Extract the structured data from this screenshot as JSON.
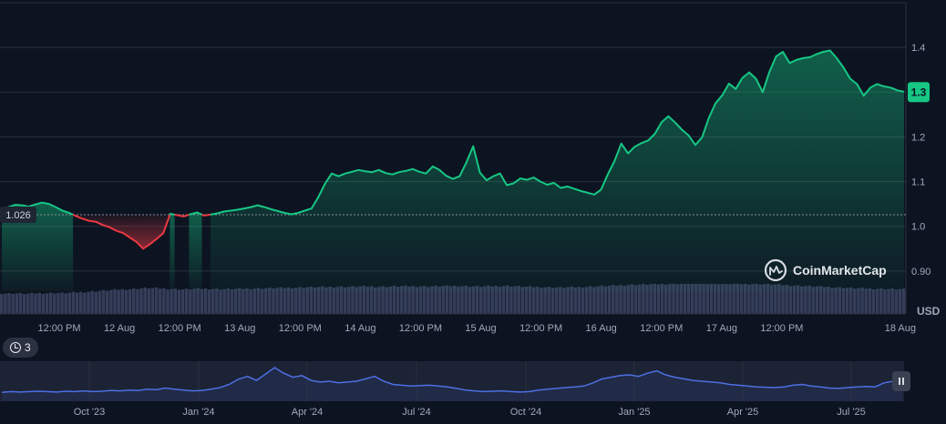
{
  "brand": {
    "name": "CoinMarketCap"
  },
  "currency_label": "USD",
  "history_badge": {
    "count": "3"
  },
  "last_price_label": "1.3",
  "start_price_label": "1.026",
  "colors": {
    "up": "#16c784",
    "down": "#ea3943",
    "volume": "#353e59",
    "navigator": "#4d6fe3",
    "background": "#0d1421",
    "grid": "#2a2f3d"
  },
  "chart_data": {
    "type": "area",
    "start_value": 1.026,
    "last_value": 1.3,
    "ylim": [
      0.855,
      1.506
    ],
    "y_ticks": [
      0.9,
      1.0,
      1.1,
      1.2,
      1.3,
      1.4
    ],
    "y_tick_labels": [
      "0.90",
      "1.0",
      "1.1",
      "1.2",
      "1.3",
      "1.4"
    ],
    "x_tick_labels": [
      "12:00 PM",
      "12 Aug",
      "12:00 PM",
      "13 Aug",
      "12:00 PM",
      "14 Aug",
      "12:00 PM",
      "15 Aug",
      "12:00 PM",
      "16 Aug",
      "12:00 PM",
      "17 Aug",
      "12:00 PM",
      "18 Aug"
    ],
    "price_series": [
      1.04,
      1.043,
      1.048,
      1.047,
      1.044,
      1.049,
      1.053,
      1.05,
      1.043,
      1.035,
      1.03,
      1.023,
      1.017,
      1.012,
      1.01,
      1.003,
      0.998,
      0.99,
      0.985,
      0.975,
      0.965,
      0.95,
      0.96,
      0.972,
      0.985,
      1.028,
      1.025,
      1.022,
      1.027,
      1.031,
      1.024,
      1.026,
      1.029,
      1.033,
      1.035,
      1.037,
      1.04,
      1.043,
      1.047,
      1.043,
      1.038,
      1.034,
      1.03,
      1.027,
      1.03,
      1.035,
      1.04,
      1.065,
      1.095,
      1.118,
      1.112,
      1.118,
      1.122,
      1.126,
      1.123,
      1.121,
      1.126,
      1.119,
      1.116,
      1.121,
      1.124,
      1.128,
      1.122,
      1.118,
      1.134,
      1.126,
      1.113,
      1.106,
      1.112,
      1.143,
      1.179,
      1.12,
      1.103,
      1.112,
      1.118,
      1.092,
      1.096,
      1.107,
      1.104,
      1.109,
      1.1,
      1.093,
      1.097,
      1.086,
      1.089,
      1.084,
      1.079,
      1.075,
      1.071,
      1.082,
      1.116,
      1.146,
      1.185,
      1.163,
      1.178,
      1.186,
      1.192,
      1.207,
      1.233,
      1.246,
      1.232,
      1.216,
      1.203,
      1.182,
      1.199,
      1.242,
      1.275,
      1.293,
      1.319,
      1.307,
      1.332,
      1.344,
      1.33,
      1.3,
      1.345,
      1.38,
      1.39,
      1.365,
      1.372,
      1.376,
      1.378,
      1.385,
      1.39,
      1.393,
      1.376,
      1.355,
      1.33,
      1.318,
      1.292,
      1.31,
      1.318,
      1.313,
      1.31,
      1.304,
      1.301
    ],
    "volume_series": [
      0.32,
      0.3,
      0.33,
      0.31,
      0.3,
      0.32,
      0.34,
      0.33,
      0.35,
      0.34,
      0.36,
      0.38,
      0.4,
      0.43,
      0.46,
      0.5,
      0.53,
      0.56,
      0.58,
      0.6,
      0.63,
      0.66,
      0.68,
      0.66,
      0.64,
      0.62,
      0.6,
      0.59,
      0.6,
      0.62,
      0.63,
      0.62,
      0.61,
      0.6,
      0.61,
      0.62,
      0.63,
      0.64,
      0.65,
      0.66,
      0.67,
      0.68,
      0.69,
      0.7,
      0.71,
      0.72,
      0.73,
      0.74,
      0.74,
      0.75,
      0.76,
      0.76,
      0.77,
      0.77,
      0.78,
      0.77,
      0.76,
      0.77,
      0.78,
      0.79,
      0.8,
      0.8,
      0.79,
      0.78,
      0.79,
      0.8,
      0.81,
      0.82,
      0.81,
      0.8,
      0.79,
      0.78,
      0.79,
      0.8,
      0.81,
      0.82,
      0.8,
      0.78,
      0.76,
      0.75,
      0.74,
      0.73,
      0.72,
      0.71,
      0.72,
      0.73,
      0.74,
      0.76,
      0.78,
      0.8,
      0.82,
      0.84,
      0.86,
      0.88,
      0.9,
      0.91,
      0.92,
      0.93,
      0.94,
      0.95,
      0.96,
      0.97,
      0.98,
      0.99,
      1.0,
      0.99,
      0.98,
      0.97,
      0.96,
      0.95,
      0.94,
      0.95,
      0.96,
      0.94,
      0.92,
      0.9,
      0.88,
      0.86,
      0.84,
      0.82,
      0.8,
      0.78,
      0.76,
      0.74,
      0.72,
      0.7,
      0.68,
      0.66,
      0.65,
      0.64,
      0.63,
      0.62,
      0.61,
      0.6,
      0.59
    ],
    "navigator": {
      "x_tick_labels": [
        "Oct '23",
        "Jan '24",
        "Apr '24",
        "Jul '24",
        "Oct '24",
        "Jan '25",
        "Apr '25",
        "Jul '25"
      ],
      "series": [
        0.22,
        0.24,
        0.23,
        0.24,
        0.25,
        0.24,
        0.23,
        0.25,
        0.24,
        0.26,
        0.24,
        0.25,
        0.27,
        0.26,
        0.28,
        0.27,
        0.3,
        0.29,
        0.33,
        0.3,
        0.28,
        0.26,
        0.27,
        0.3,
        0.34,
        0.42,
        0.55,
        0.62,
        0.52,
        0.68,
        0.84,
        0.7,
        0.6,
        0.64,
        0.52,
        0.48,
        0.5,
        0.46,
        0.48,
        0.5,
        0.56,
        0.62,
        0.5,
        0.42,
        0.4,
        0.38,
        0.39,
        0.4,
        0.38,
        0.36,
        0.32,
        0.28,
        0.26,
        0.24,
        0.25,
        0.26,
        0.24,
        0.23,
        0.24,
        0.28,
        0.3,
        0.32,
        0.34,
        0.36,
        0.38,
        0.46,
        0.56,
        0.6,
        0.64,
        0.66,
        0.62,
        0.7,
        0.76,
        0.66,
        0.6,
        0.56,
        0.52,
        0.5,
        0.48,
        0.46,
        0.42,
        0.4,
        0.38,
        0.36,
        0.35,
        0.34,
        0.36,
        0.4,
        0.42,
        0.38,
        0.36,
        0.33,
        0.32,
        0.34,
        0.36,
        0.37,
        0.36,
        0.46,
        0.5,
        0.52
      ]
    }
  }
}
